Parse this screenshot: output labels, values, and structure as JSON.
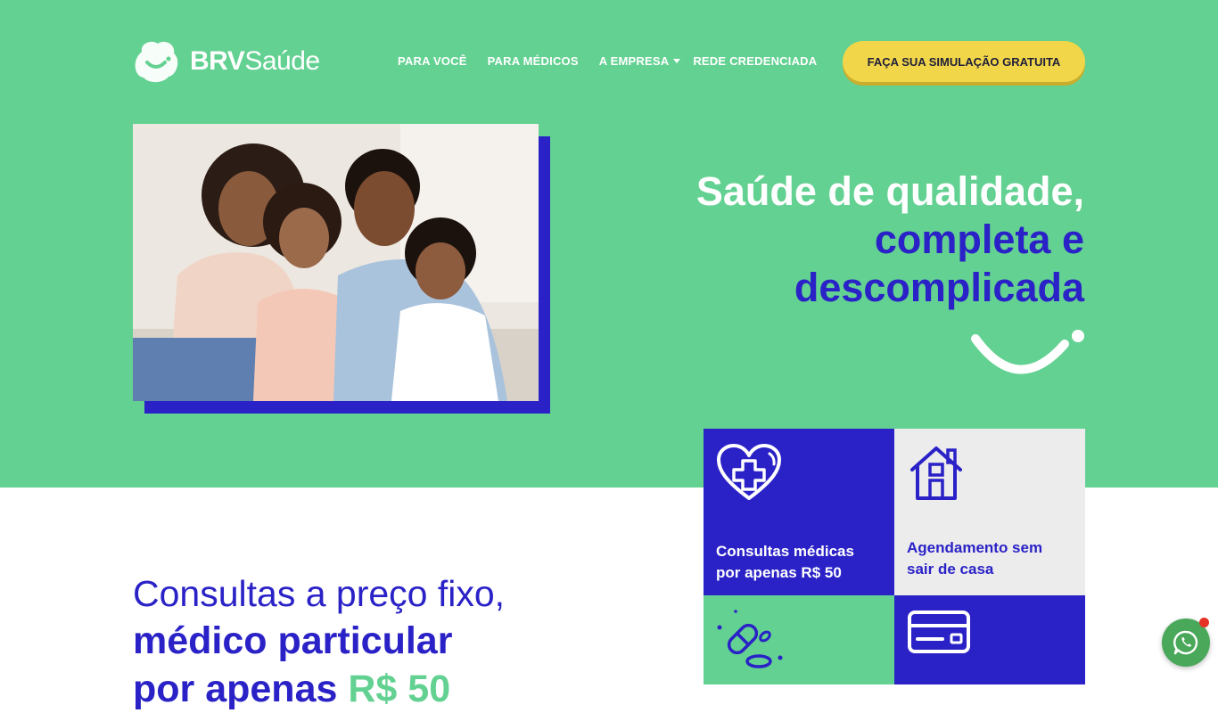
{
  "brand": {
    "name_bold": "BRV",
    "name_light": "Saúde",
    "logo_icon": "smile-cloud-icon"
  },
  "nav": {
    "items": [
      {
        "label": "PARA VOCÊ"
      },
      {
        "label": "PARA MÉDICOS"
      },
      {
        "label": "A EMPRESA",
        "has_dropdown": true
      },
      {
        "label": "REDE CREDENCIADA"
      }
    ],
    "cta_label": "FAÇA SUA SIMULAÇÃO GRATUITA"
  },
  "hero": {
    "headline_line1": "Saúde de qualidade,",
    "headline_line2": "completa e",
    "headline_line3": "descomplicada",
    "image_icon": "family-photo"
  },
  "features": [
    {
      "icon": "heart-cross-icon",
      "label_line1": "Consultas médicas",
      "label_line2": "por apenas R$ 50"
    },
    {
      "icon": "house-icon",
      "label_line1": "Agendamento sem",
      "label_line2": "sair de casa"
    },
    {
      "icon": "pills-icon"
    },
    {
      "icon": "credit-card-icon"
    }
  ],
  "section": {
    "line1": "Consultas a preço fixo,",
    "line2": "médico particular",
    "line3_text": "por apenas ",
    "line3_price": "R$ 50"
  },
  "colors": {
    "green": "#63d192",
    "blue": "#2a22c7",
    "yellow": "#f1d64a",
    "white": "#ffffff"
  }
}
